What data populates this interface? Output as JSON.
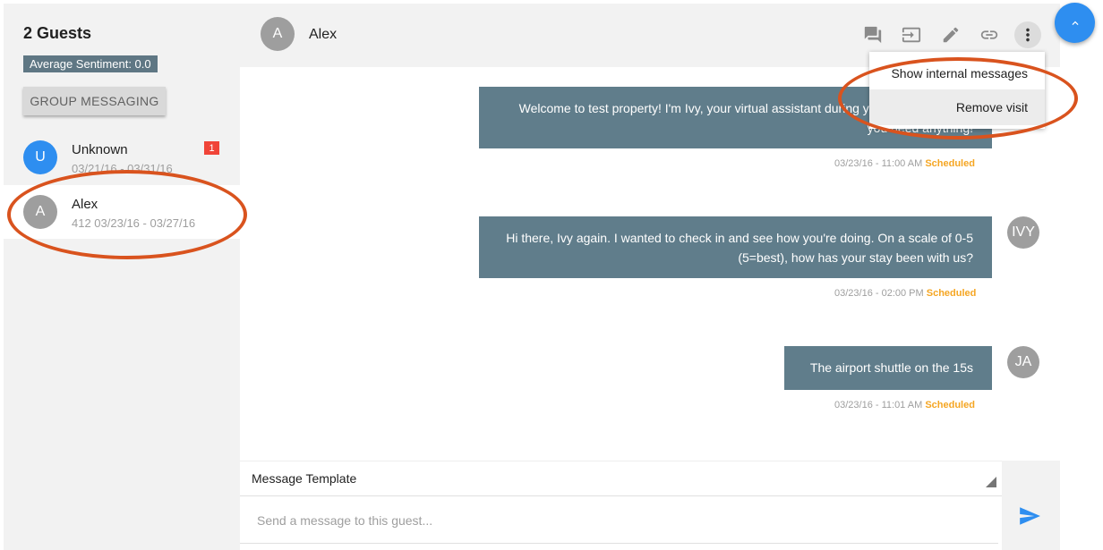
{
  "sidebar": {
    "guest_count": "2 Guests",
    "sentiment": "Average Sentiment: 0.0",
    "group_button": "GROUP MESSAGING",
    "guests": [
      {
        "initial": "U",
        "name": "Unknown",
        "dates": "03/21/16 - 03/31/16",
        "unread": "1",
        "avatar_color": "#2e8ef0"
      },
      {
        "initial": "A",
        "name": "Alex",
        "dates": "412 03/23/16 - 03/27/16",
        "avatar_color": "#9e9e9e"
      }
    ]
  },
  "header": {
    "initial": "A",
    "name": "Alex",
    "icons": [
      "chat-icon",
      "checkout-icon",
      "edit-icon",
      "link-icon",
      "more-vert-icon"
    ]
  },
  "menu": {
    "items": [
      "Show internal messages",
      "Remove visit"
    ]
  },
  "messages": [
    {
      "text": "Welcome to test property! I'm Ivy, your virtual assistant during your stay. Text me if you need anything!",
      "time": "03/23/16 - 11:00 AM",
      "status": "Scheduled"
    },
    {
      "text": "Hi there, Ivy again. I wanted to check in and see how you're doing. On a scale of 0-5 (5=best), how has your stay been with us?",
      "time": "03/23/16 - 02:00 PM",
      "status": "Scheduled",
      "avatar": "IVY"
    },
    {
      "text": "The airport shuttle on the 15s",
      "time": "03/23/16 - 11:01 AM",
      "status": "Scheduled",
      "avatar": "JA"
    }
  ],
  "composer": {
    "template_label": "Message Template",
    "placeholder": "Send a message to this guest..."
  },
  "colors": {
    "accent": "#2e8ef0",
    "bubble": "#607d8b",
    "scheduled": "#f5a623",
    "annotation": "#d9531e",
    "badge": "#f04438"
  }
}
